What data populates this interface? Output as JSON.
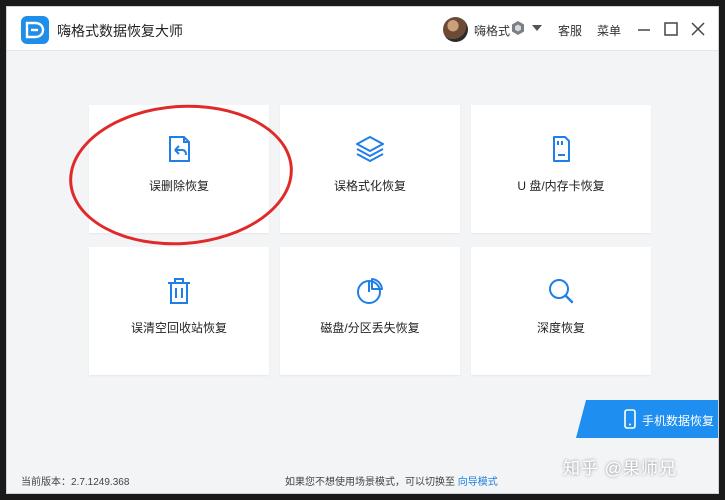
{
  "app": {
    "title": "嗨格式数据恢复大师"
  },
  "user": {
    "name": "嗨格式"
  },
  "header_menu": {
    "service": "客服",
    "menu": "菜单"
  },
  "cards": [
    {
      "label": "误删除恢复",
      "icon": "deleted-file-restore-icon"
    },
    {
      "label": "误格式化恢复",
      "icon": "layers-icon"
    },
    {
      "label": "U 盘/内存卡恢复",
      "icon": "sd-card-icon"
    },
    {
      "label": "误清空回收站恢复",
      "icon": "trash-icon"
    },
    {
      "label": "磁盘/分区丢失恢复",
      "icon": "pie-chart-icon"
    },
    {
      "label": "深度恢复",
      "icon": "magnifier-icon"
    }
  ],
  "mobile_recovery": {
    "label": "手机数据恢复"
  },
  "footer": {
    "version_label": "当前版本：2.7.1249.368",
    "hint": "如果您不想使用场景模式，可以切换至",
    "link": "向导模式"
  },
  "watermark": "知乎 @果师兄",
  "colors": {
    "accent": "#1e8ef0",
    "icon": "#1f7fe6",
    "highlight": "#e02a2a"
  }
}
